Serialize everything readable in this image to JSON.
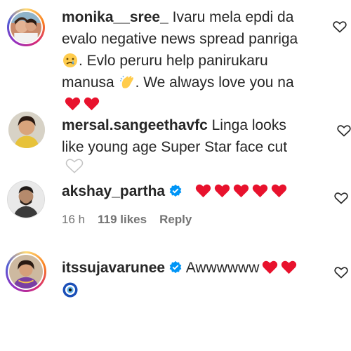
{
  "comments": [
    {
      "username": "monika__sree_",
      "text_line1": " Ivaru mela epdi da",
      "text_line2": "evalo negative news spread panriga",
      "text_line3": ". Evlo peruru help panirukaru",
      "text_line4": "manusa",
      "text_line4b": ". We always love you na",
      "emoji_cry": "crying-face",
      "emoji_clap": "clapping-hands"
    },
    {
      "username": "mersal.sangeethavfc",
      "text_line1": " Linga looks",
      "text_line2": "like young age Super Star face cut"
    },
    {
      "username": "akshay_partha",
      "verified": true,
      "time": "16 h",
      "likes": "119 likes",
      "reply": "Reply"
    },
    {
      "username": "itssujavarunee",
      "verified": true,
      "text": " Awwwwww"
    }
  ],
  "colors": {
    "heart_red": "#e8122d",
    "verified_blue": "#0095f6",
    "meta_gray": "#737373"
  }
}
